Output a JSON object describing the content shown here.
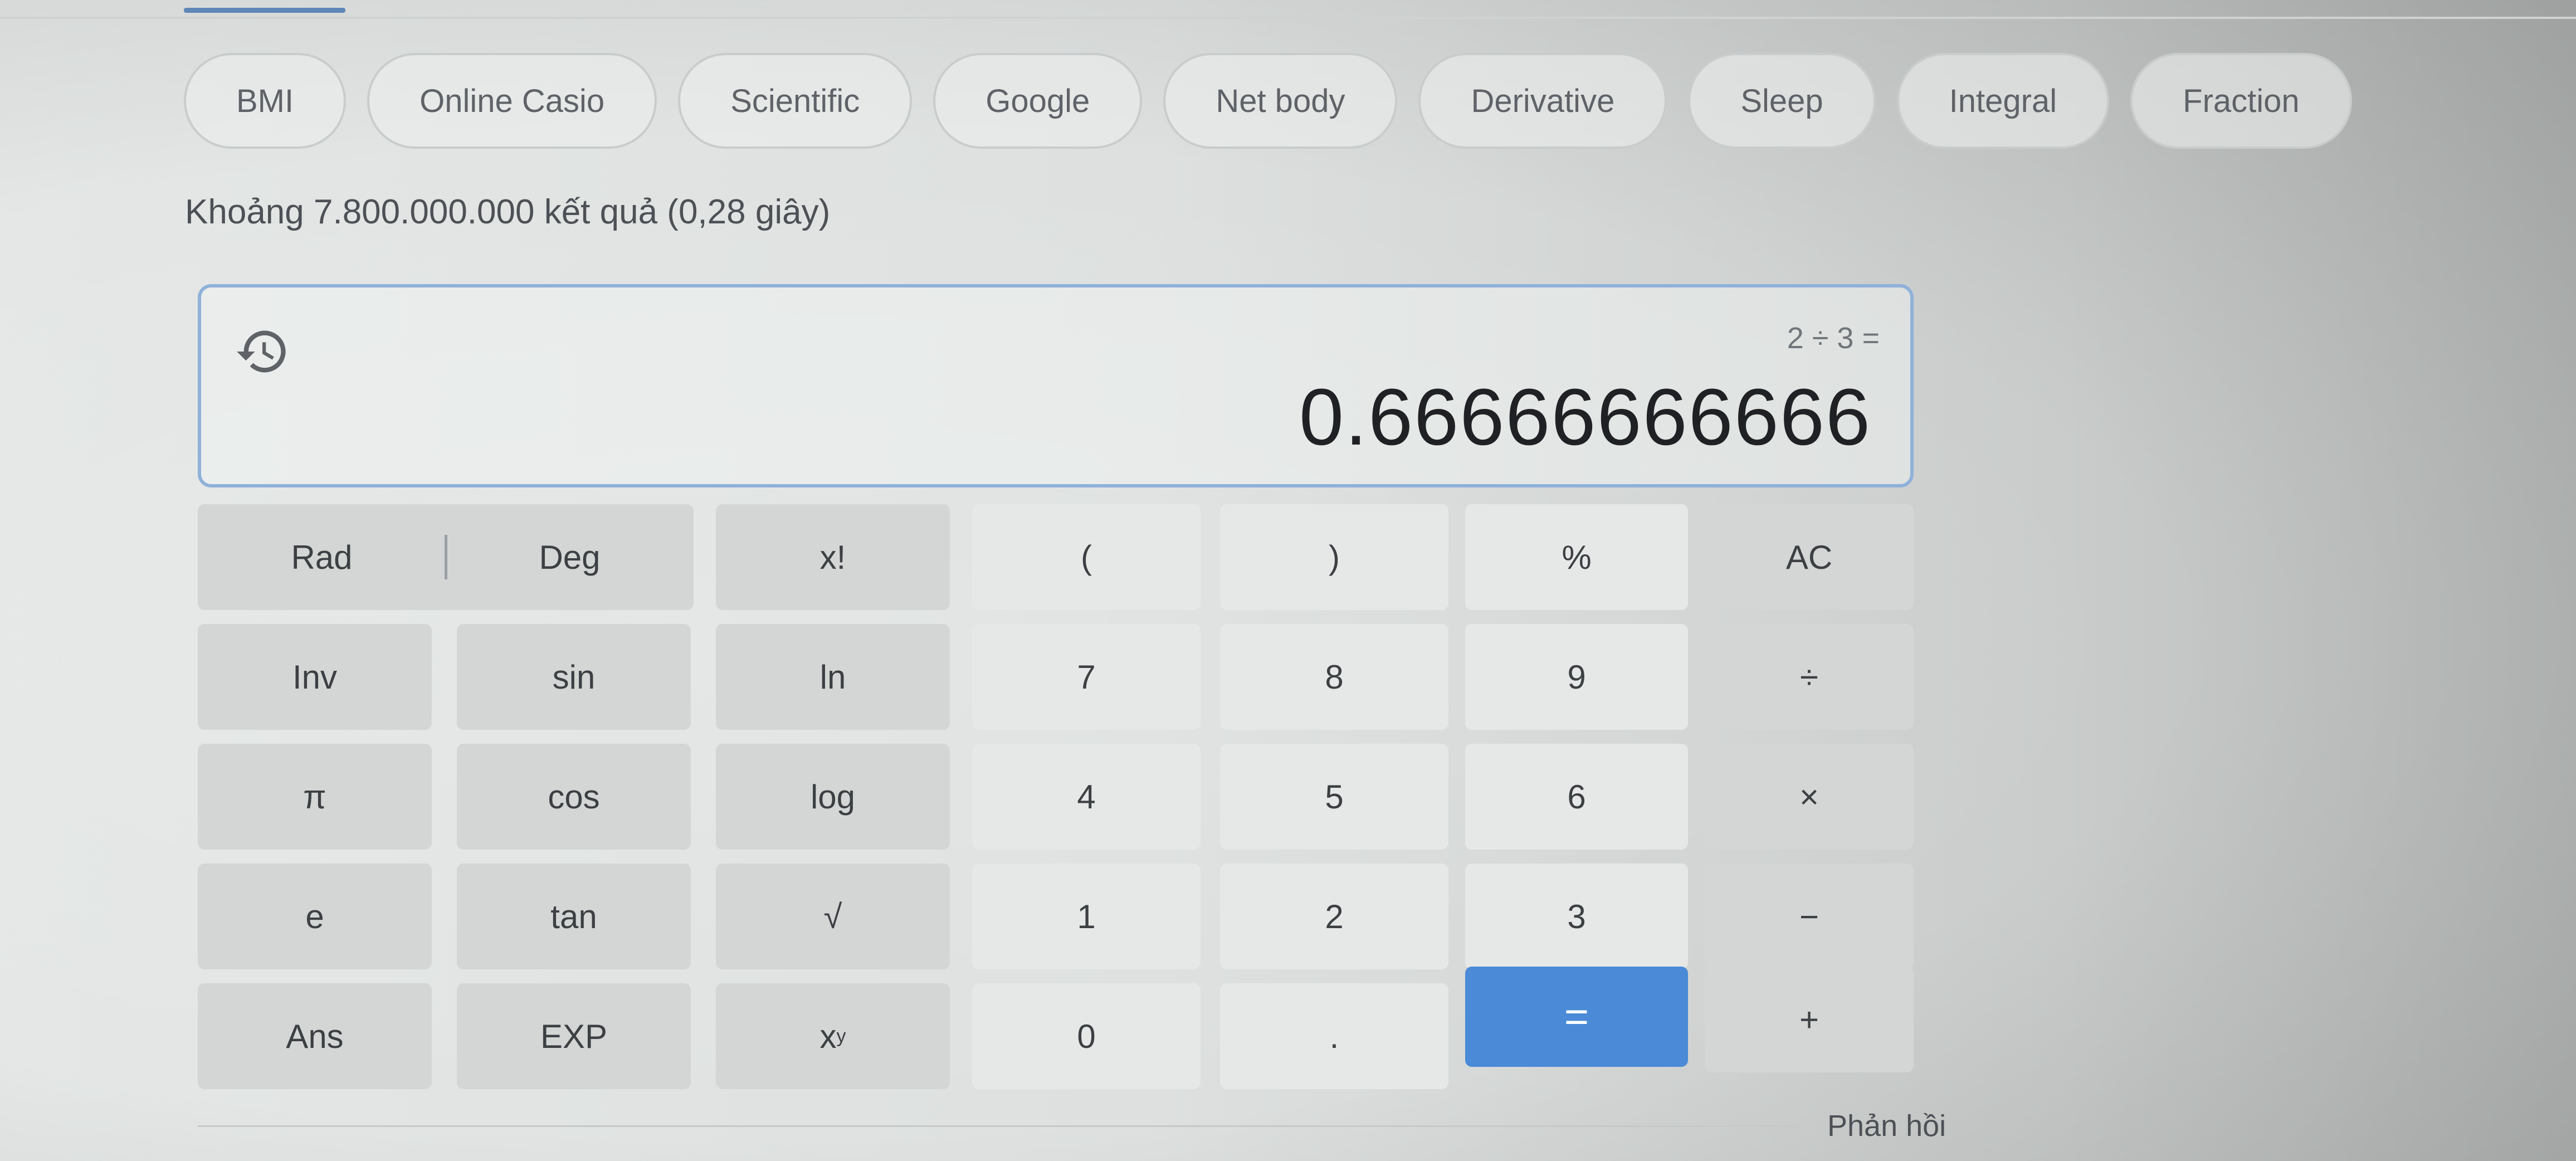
{
  "chips": [
    {
      "label": "BMI"
    },
    {
      "label": "Online Casio"
    },
    {
      "label": "Scientific"
    },
    {
      "label": "Google"
    },
    {
      "label": "Net body"
    },
    {
      "label": "Derivative"
    },
    {
      "label": "Sleep"
    },
    {
      "label": "Integral"
    },
    {
      "label": "Fraction"
    }
  ],
  "result_stats": "Khoảng 7.800.000.000 kết quả (0,28 giây)",
  "calculator": {
    "history_icon": "history-icon",
    "expression": "2 ÷ 3 =",
    "result": "0.66666666666",
    "keys": {
      "rad": "Rad",
      "deg": "Deg",
      "factorial": "x!",
      "open_paren": "(",
      "close_paren": ")",
      "percent": "%",
      "clear": "AC",
      "inv": "Inv",
      "sin": "sin",
      "ln": "ln",
      "seven": "7",
      "eight": "8",
      "nine": "9",
      "divide": "÷",
      "pi": "π",
      "cos": "cos",
      "log": "log",
      "four": "4",
      "five": "5",
      "six": "6",
      "multiply": "×",
      "e": "e",
      "tan": "tan",
      "sqrt": "√",
      "one": "1",
      "two": "2",
      "three": "3",
      "minus": "−",
      "ans": "Ans",
      "exp": "EXP",
      "power_base": "x",
      "power_exp": "y",
      "zero": "0",
      "dot": ".",
      "equals": "=",
      "plus": "+"
    },
    "colors": {
      "equals_key": "#4a8ad6",
      "display_border": "#8fb1da"
    }
  },
  "feedback": "Phản hồi"
}
